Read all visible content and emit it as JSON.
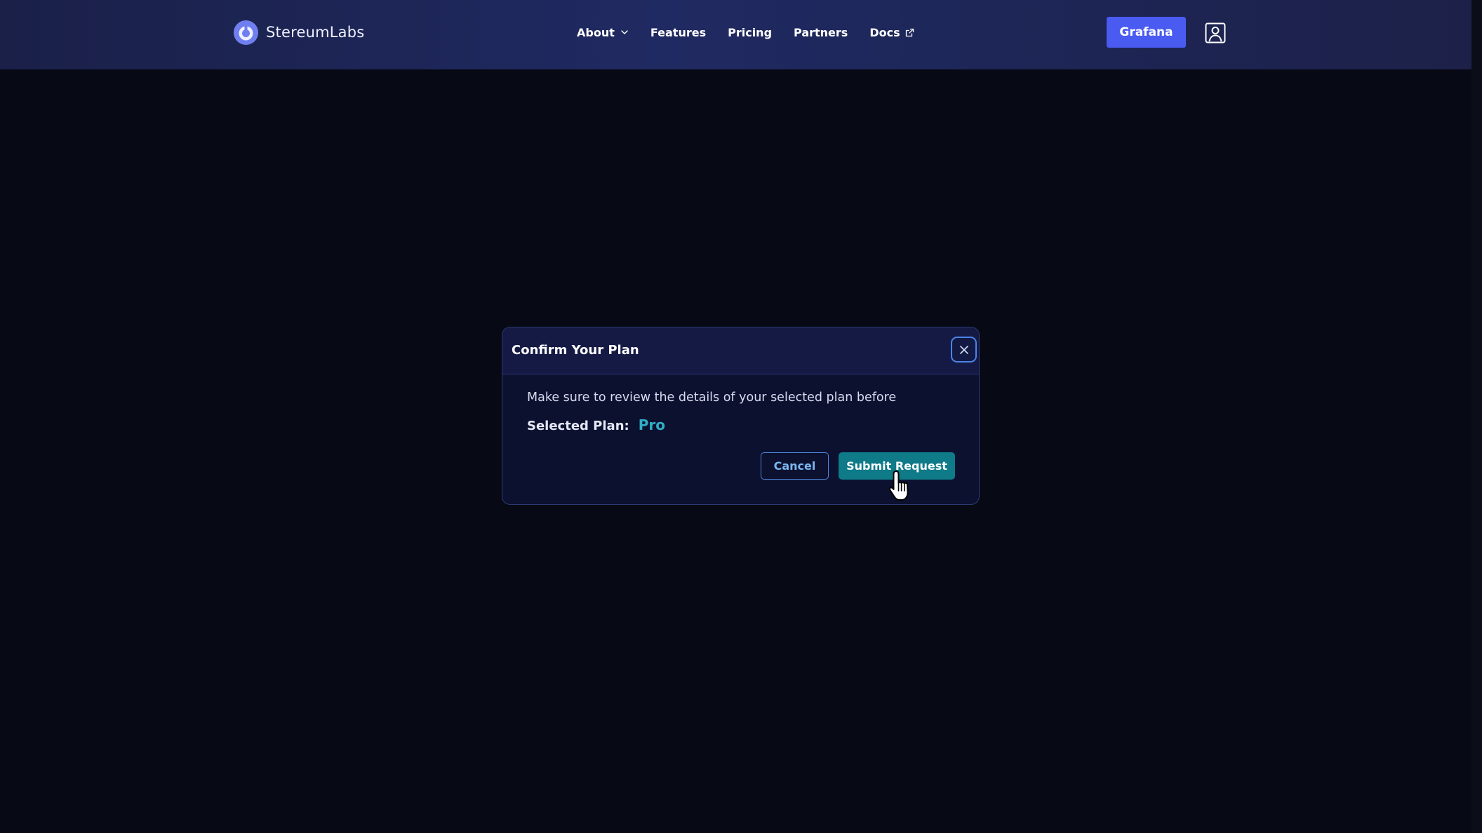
{
  "nav": {
    "brand_name": "StereumLabs",
    "links": [
      {
        "label": "About",
        "icon": "chevron-down-icon"
      },
      {
        "label": "Features"
      },
      {
        "label": "Pricing"
      },
      {
        "label": "Partners"
      },
      {
        "label": "Docs",
        "icon": "external-link-icon"
      }
    ],
    "cta_label": "Grafana",
    "user_icon": "user-icon"
  },
  "modal": {
    "title": "Confirm Your Plan",
    "close_icon": "close-icon",
    "message": "Make sure to review the details of your selected plan before",
    "selected_plan_label": "Selected Plan:",
    "selected_plan_value": "Pro",
    "cancel_label": "Cancel",
    "submit_label": "Submit Request"
  },
  "colors": {
    "background": "#070914",
    "navbar": "#202a62",
    "primary_button": "#4a5bf2",
    "submit_button": "#0f7a88",
    "plan_value": "#2fb0c6",
    "cancel_outline": "#4f85d8"
  }
}
